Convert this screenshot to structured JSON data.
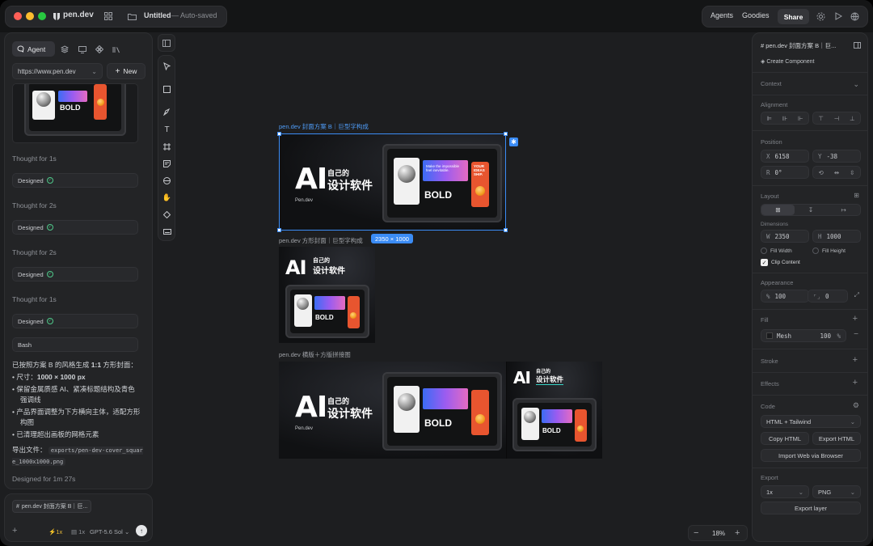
{
  "topbar": {
    "brand": "pen.dev",
    "doc_title": "Untitled",
    "doc_status": "— Auto-saved",
    "agents": "Agents",
    "goodies": "Goodies",
    "share": "Share"
  },
  "left": {
    "tab_agent": "Agent",
    "url_value": "https://www.pen.dev",
    "new_button": "New",
    "steps": [
      {
        "thought": "Thought for 1s",
        "chip": "Designed"
      },
      {
        "thought": "Thought for 2s",
        "chip": "Designed"
      },
      {
        "thought": "Thought for 2s",
        "chip": "Designed"
      },
      {
        "thought": "Thought for 1s",
        "chip": "Designed"
      }
    ],
    "bash_chip": "Bash",
    "summary_prefix": "已按照方案 B 的风格生成 ",
    "summary_bold": "1:1",
    "summary_suffix": " 方形封面：",
    "bullets": [
      {
        "label": "尺寸：",
        "bold": "1000 × 1000 px"
      },
      {
        "label": "保留金属质感 AI、紧凑标题结构及青色强调线",
        "bold": ""
      },
      {
        "label": "产品界面调整为下方横向主体，适配方形构图",
        "bold": ""
      },
      {
        "label": "已清理超出画板的网格元素",
        "bold": ""
      }
    ],
    "export_label": "导出文件：",
    "export_path": "exports/pen-dev-cover_square_1000x1000.png",
    "designed_for": "Designed for 1m 27s",
    "composer_tag": "pen.dev 封面方案 B｜巨...",
    "speed": "1x",
    "count": "1x",
    "model": "GPT-5.6 Sol"
  },
  "canvas": {
    "frame1_label": "pen.dev 封面方案 B｜巨型字构成",
    "frame2_label": "pen.dev 方形封面｜巨型字构成",
    "frame2_size": "2350 × 1000",
    "frame3_label": "pen.dev 横版＋方版拼接图",
    "ai_text": "AI",
    "cn_line1": "自己的",
    "cn_line2": "设计软件",
    "brand_small": "Pen.dev",
    "bold_word": "BOLD",
    "gradient_text": "Make the impossible feel inevitable.",
    "orange_text": "YOUR IDEAS SHIP.",
    "zoom": "18%"
  },
  "right": {
    "layer_title": "pen.dev 封面方案 B｜巨...",
    "create_component": "Create Component",
    "context": "Context",
    "alignment": "Alignment",
    "position": "Position",
    "x_label": "X",
    "x_value": "6158",
    "y_label": "Y",
    "y_value": "-38",
    "r_label": "R",
    "r_value": "0°",
    "layout": "Layout",
    "dimensions": "Dimensions",
    "w_label": "W",
    "w_value": "2350",
    "h_label": "H",
    "h_value": "1000",
    "fill_width": "Fill Width",
    "fill_height": "Fill Height",
    "clip_content": "Clip Content",
    "appearance": "Appearance",
    "opacity_label": "%",
    "opacity_value": "100",
    "radius_value": "0",
    "fill": "Fill",
    "fill_name": "Mesh",
    "fill_opacity": "100",
    "fill_pct": "%",
    "stroke": "Stroke",
    "effects": "Effects",
    "code": "Code",
    "code_format": "HTML + Tailwind",
    "copy_html": "Copy HTML",
    "export_html": "Export HTML",
    "import_web": "Import Web via Browser",
    "export": "Export",
    "scale": "1x",
    "format": "PNG",
    "export_layer": "Export layer"
  },
  "colors": {
    "accent": "#3b8cf5",
    "success": "#4fc98a",
    "orange": "#e8552f"
  }
}
